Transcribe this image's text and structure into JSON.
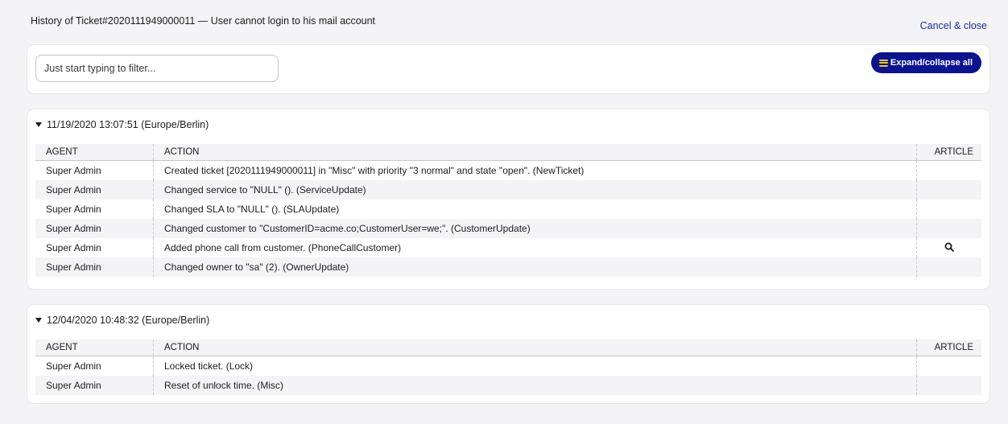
{
  "header": {
    "title": "History of Ticket#2020111949000011 — User cannot login to his mail account",
    "cancel_label": "Cancel & close"
  },
  "filter": {
    "placeholder": "Just start typing to filter...",
    "expand_label": "Expand/collapse all"
  },
  "columns": {
    "agent": "AGENT",
    "action": "ACTION",
    "article": "ARTICLE"
  },
  "groups": [
    {
      "date": "11/19/2020 13:07:51 (Europe/Berlin)",
      "rows": [
        {
          "agent": "Super Admin",
          "action": "Created ticket [2020111949000011] in \"Misc\" with priority \"3 normal\" and state \"open\". (NewTicket)",
          "article": ""
        },
        {
          "agent": "Super Admin",
          "action": "Changed service to \"NULL\" (). (ServiceUpdate)",
          "article": ""
        },
        {
          "agent": "Super Admin",
          "action": "Changed SLA to \"NULL\" (). (SLAUpdate)",
          "article": ""
        },
        {
          "agent": "Super Admin",
          "action": "Changed customer to \"CustomerID=acme.co;CustomerUser=we;\". (CustomerUpdate)",
          "article": ""
        },
        {
          "agent": "Super Admin",
          "action": "Added phone call from customer. (PhoneCallCustomer)",
          "article": "zoom-icon"
        },
        {
          "agent": "Super Admin",
          "action": "Changed owner to \"sa\" (2). (OwnerUpdate)",
          "article": ""
        }
      ]
    },
    {
      "date": "12/04/2020 10:48:32 (Europe/Berlin)",
      "rows": [
        {
          "agent": "Super Admin",
          "action": "Locked ticket. (Lock)",
          "article": ""
        },
        {
          "agent": "Super Admin",
          "action": "Reset of unlock time. (Misc)",
          "article": ""
        }
      ]
    }
  ],
  "colors": {
    "accent": "#0a1391",
    "link": "#1f2ab0",
    "menu_icon": "#f5c518"
  }
}
